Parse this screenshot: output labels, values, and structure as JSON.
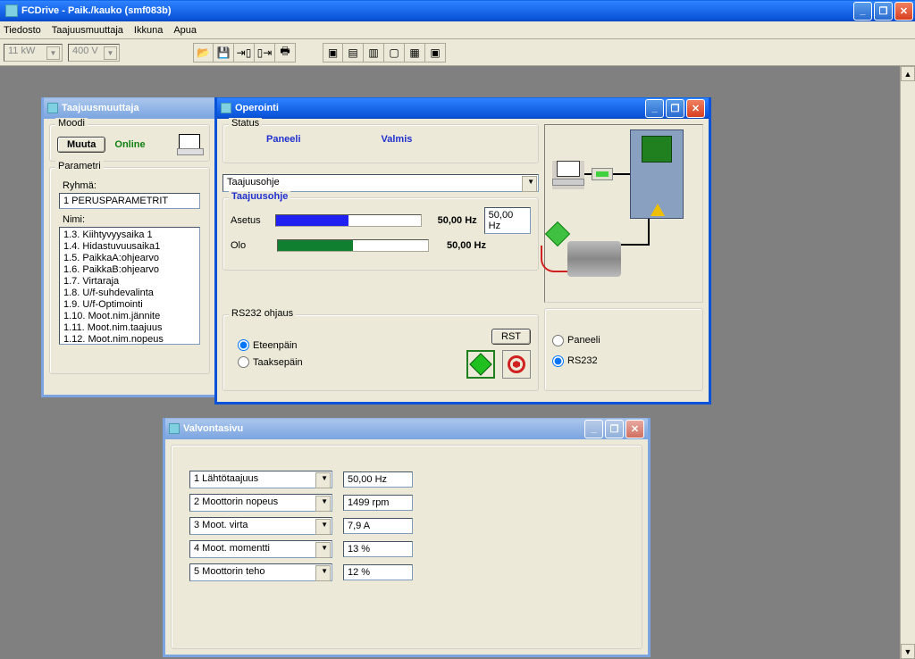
{
  "app": {
    "title": "FCDrive - Paik./kauko (smf083b)"
  },
  "menu": {
    "file": "Tiedosto",
    "converter": "Taajuusmuuttaja",
    "window": "Ikkuna",
    "help": "Apua"
  },
  "toolbar": {
    "power": "11 kW",
    "voltage": "400 V"
  },
  "win_converter": {
    "title": "Taajuusmuuttaja",
    "mode_label": "Moodi",
    "change_btn": "Muuta",
    "status": "Online",
    "param_label": "Parametri",
    "group_label": "Ryhmä:",
    "group_value": "1 PERUSPARAMETRIT",
    "name_label": "Nimi:",
    "items": [
      "1.3. Kiihtyvyysaika 1",
      "1.4. Hidastuvuusaika1",
      "1.5. PaikkaA:ohjearvo",
      "1.6. PaikkaB:ohjearvo",
      "1.7. Virtaraja",
      "1.8. U/f-suhdevalinta",
      "1.9. U/f-Optimointi",
      "1.10. Moot.nim.jännite",
      "1.11. Moot.nim.taajuus",
      "1.12. Moot.nim.nopeus"
    ]
  },
  "win_operation": {
    "title": "Operointi",
    "status_label": "Status",
    "status_panel": "Paneeli",
    "status_ready": "Valmis",
    "ref_select": "Taajuusohje",
    "ref_group": "Taajuusohje",
    "setpoint_label": "Asetus",
    "setpoint_value": "50,00 Hz",
    "setpoint_field": "50,00 Hz",
    "actual_label": "Olo",
    "actual_value": "50,00 Hz",
    "rs232_label": "RS232 ohjaus",
    "forward": "Eteenpäin",
    "backward": "Taaksepäin",
    "rst": "RST",
    "radio_panel": "Paneeli",
    "radio_rs232": "RS232"
  },
  "win_monitor": {
    "title": "Valvontasivu",
    "rows": [
      {
        "label": "1 Lähtötaajuus",
        "value": "50,00 Hz"
      },
      {
        "label": "2 Moottorin nopeus",
        "value": "1499 rpm"
      },
      {
        "label": "3 Moot. virta",
        "value": "7,9 A"
      },
      {
        "label": "4 Moot. momentti",
        "value": "13 %"
      },
      {
        "label": "5 Moottorin teho",
        "value": "12 %"
      }
    ]
  }
}
